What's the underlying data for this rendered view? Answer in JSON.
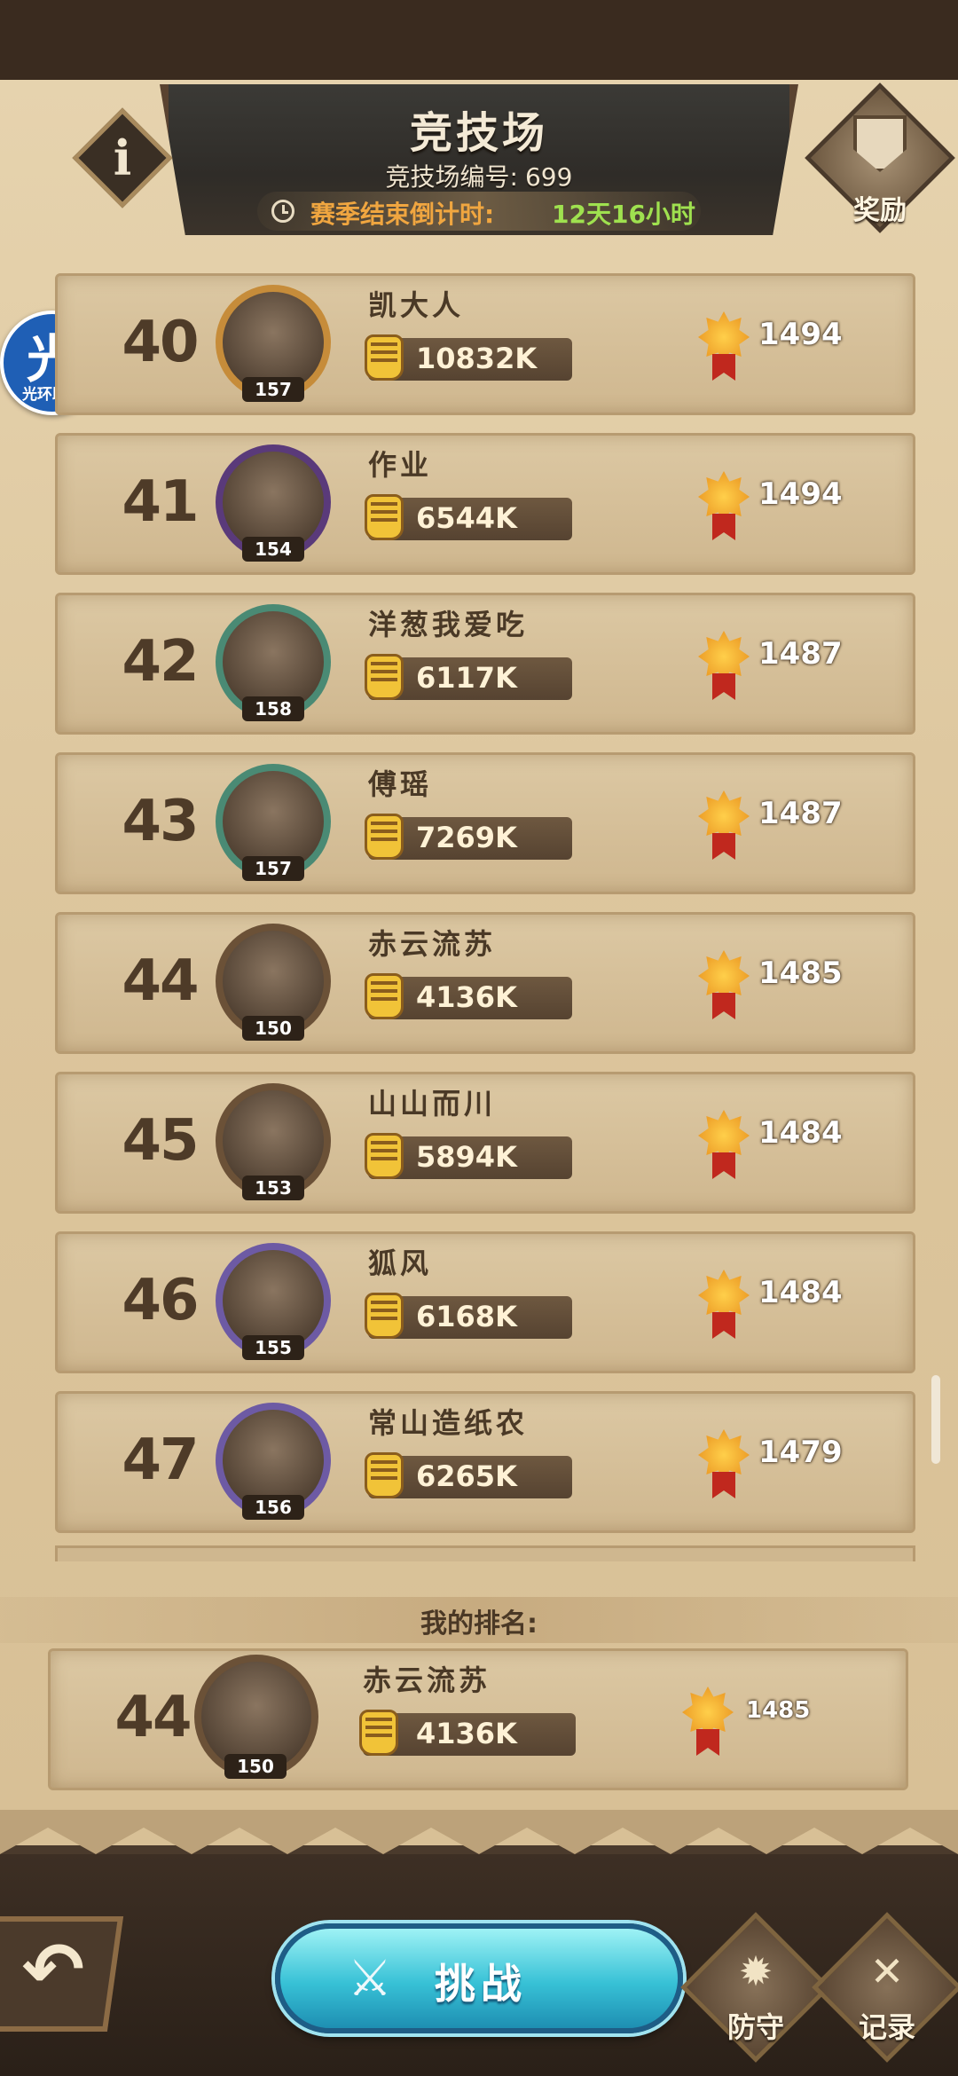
{
  "header": {
    "title": "竞技场",
    "arena_id_label": "竞技场编号:",
    "arena_id_value": "699",
    "countdown_label": "赛季结束倒计时:",
    "countdown_value": "12天16小时",
    "reward_label": "奖励",
    "info_glyph": "i"
  },
  "watermark": {
    "main": "光",
    "sub": "光环助手"
  },
  "rankings": [
    {
      "rank": "40",
      "name": "凯大人",
      "level": "157",
      "power": "10832K",
      "points": "1494"
    },
    {
      "rank": "41",
      "name": "作业",
      "level": "154",
      "power": "6544K",
      "points": "1494"
    },
    {
      "rank": "42",
      "name": "洋葱我爱吃",
      "level": "158",
      "power": "6117K",
      "points": "1487"
    },
    {
      "rank": "43",
      "name": "傅瑶",
      "level": "157",
      "power": "7269K",
      "points": "1487"
    },
    {
      "rank": "44",
      "name": "赤云流苏",
      "level": "150",
      "power": "4136K",
      "points": "1485"
    },
    {
      "rank": "45",
      "name": "山山而川",
      "level": "153",
      "power": "5894K",
      "points": "1484"
    },
    {
      "rank": "46",
      "name": "狐风",
      "level": "155",
      "power": "6168K",
      "points": "1484"
    },
    {
      "rank": "47",
      "name": "常山造纸农",
      "level": "156",
      "power": "6265K",
      "points": "1479"
    }
  ],
  "my_rank": {
    "label": "我的排名:",
    "rank": "44",
    "name": "赤云流苏",
    "level": "150",
    "power": "4136K",
    "points": "1485"
  },
  "bottom": {
    "challenge_label": "挑战",
    "defense_label": "防守",
    "record_label": "记录",
    "back_glyph": "↶"
  },
  "colors": {
    "countdown_label": "#f0a640",
    "countdown_value": "#9fe14f",
    "challenge_button": "#37c1d6"
  }
}
